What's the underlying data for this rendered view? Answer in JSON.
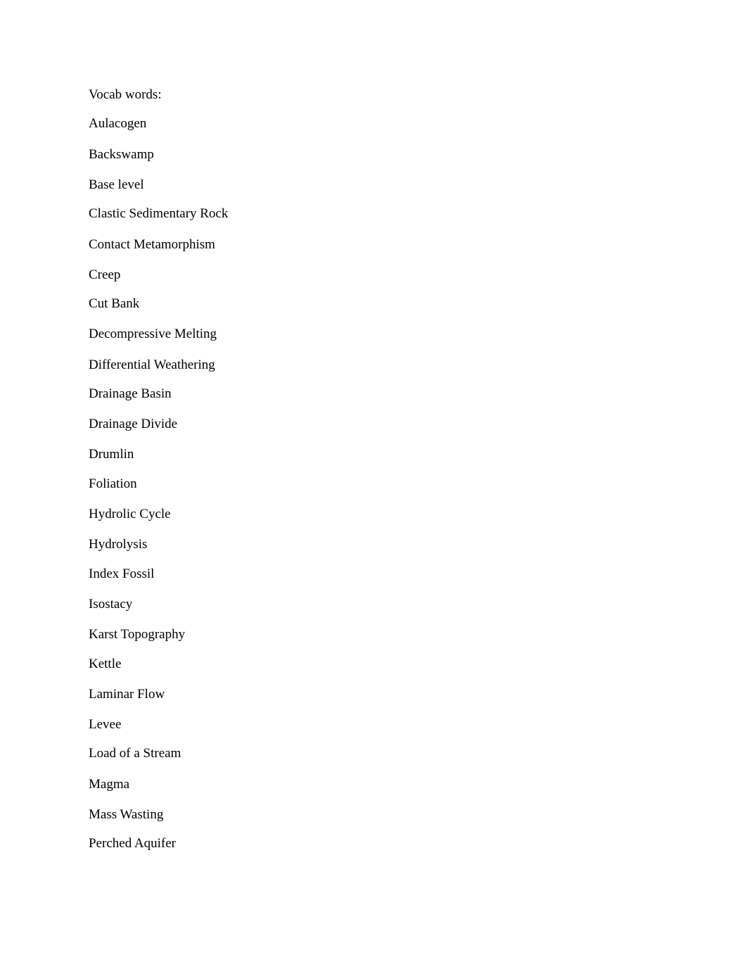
{
  "document": {
    "heading": "Vocab words:",
    "words": [
      "Aulacogen",
      "Backswamp",
      "Base level",
      "Clastic Sedimentary Rock",
      "Contact Metamorphism",
      "Creep",
      "Cut Bank",
      "Decompressive Melting",
      "Differential Weathering",
      "Drainage Basin",
      "Drainage Divide",
      "Drumlin",
      "Foliation",
      "Hydrolic Cycle",
      "Hydrolysis",
      "Index Fossil",
      "Isostacy",
      "Karst Topography",
      "Kettle",
      "Laminar Flow",
      "Levee",
      "Load of a Stream",
      "Magma",
      "Mass Wasting",
      "Perched Aquifer"
    ]
  }
}
